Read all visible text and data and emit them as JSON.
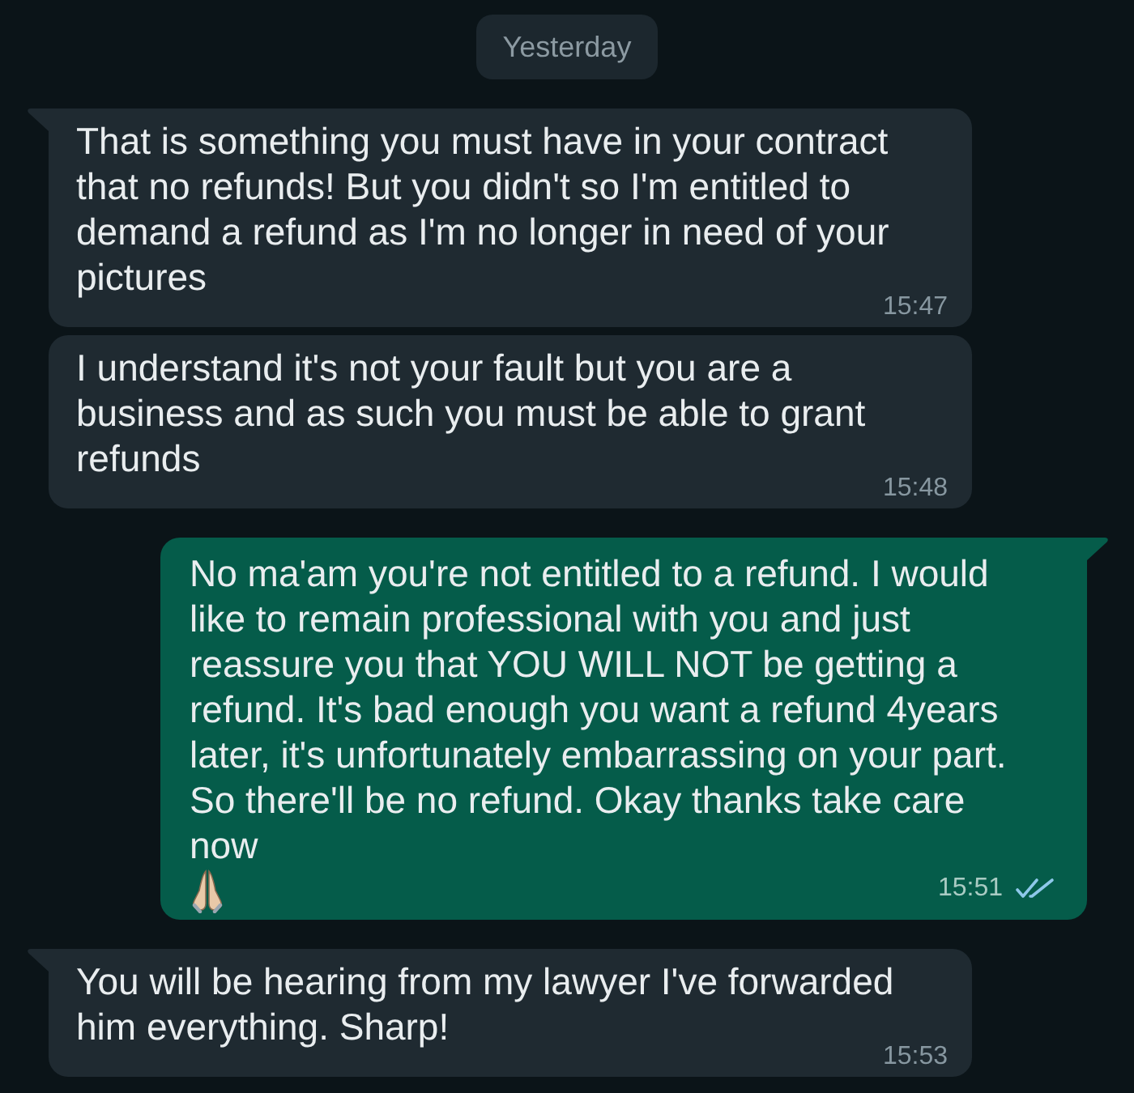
{
  "date_chip": {
    "label": "Yesterday"
  },
  "messages": [
    {
      "kind": "incoming",
      "tail": true,
      "text": "That is something you must have in your contract that no refunds! But you didn't so I'm entitled to demand a refund as I'm no longer in need of your pictures",
      "time": "15:47"
    },
    {
      "kind": "incoming",
      "tail": false,
      "text": "I understand it's not your fault but you are a business and as such you must be able to grant refunds",
      "time": "15:48"
    },
    {
      "kind": "outgoing",
      "tail": true,
      "text": "No ma'am you're not entitled to a refund. I would like to remain professional with you and just reassure you that YOU WILL NOT be getting a refund. It's bad enough you want a refund 4years later, it's unfortunately embarrassing on your part. So there'll be no refund. Okay thanks take care now",
      "emoji": true,
      "time": "15:51",
      "read": true
    },
    {
      "kind": "incoming",
      "tail": true,
      "text": "You will be hearing from my lawyer I've forwarded him everything. Sharp!",
      "time": "15:53"
    }
  ]
}
